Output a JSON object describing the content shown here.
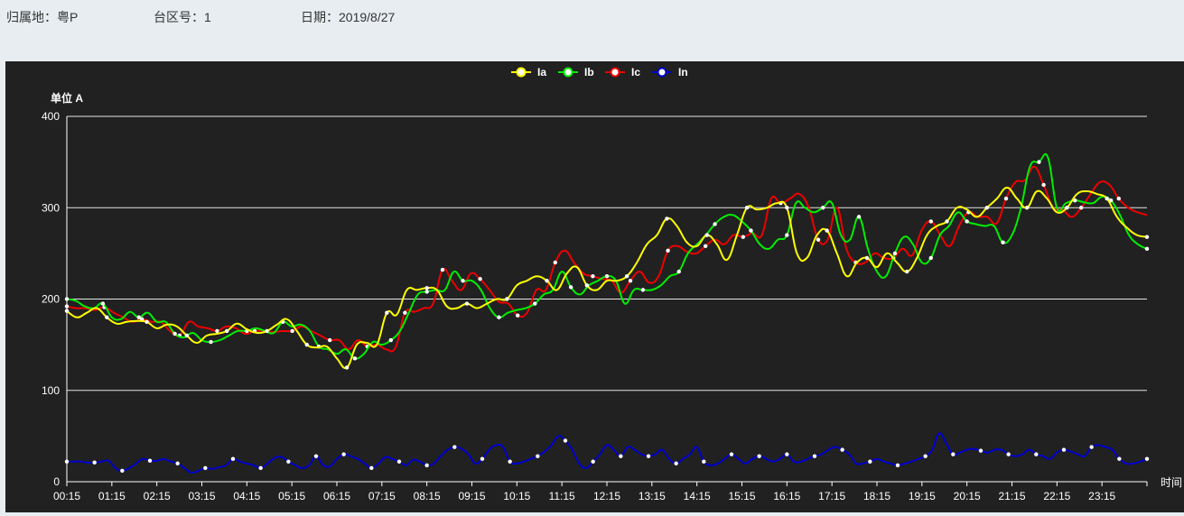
{
  "header": {
    "region_label": "归属地：",
    "region_value": "粤P",
    "station_label": "台区号：",
    "station_value": "1",
    "date_label": "日期：",
    "date_value": "2019/8/27"
  },
  "colors": {
    "page_bg": "#e8edf1",
    "chart_bg": "#212121",
    "Ia": "#ffff00",
    "Ib": "#00ee00",
    "Ic": "#ee0000",
    "In": "#0000cc"
  },
  "chart_data": {
    "type": "line",
    "ylabel": "单位 A",
    "xlabel": "时间",
    "ylim": [
      0,
      400
    ],
    "yticks": [
      0,
      100,
      200,
      300,
      400
    ],
    "grid": "horizontal",
    "legend_position": "top-center",
    "smooth": true,
    "x_tick_labels": [
      "00:15",
      "01:15",
      "02:15",
      "03:15",
      "04:15",
      "05:15",
      "06:15",
      "07:15",
      "08:15",
      "09:15",
      "10:15",
      "11:15",
      "12:15",
      "13:15",
      "14:15",
      "15:15",
      "16:15",
      "17:15",
      "18:15",
      "19:15",
      "20:15",
      "21:15",
      "22:15",
      "23:15"
    ],
    "x_start": "00:15",
    "x_interval_minutes": 15,
    "series": [
      {
        "name": "Ia",
        "values": [
          187,
          180,
          185,
          190,
          180,
          173,
          175,
          176,
          175,
          168,
          172,
          170,
          160,
          152,
          160,
          162,
          165,
          173,
          167,
          163,
          165,
          172,
          178,
          165,
          150,
          147,
          148,
          135,
          125,
          150,
          152,
          150,
          185,
          183,
          210,
          210,
          212,
          210,
          192,
          190,
          195,
          190,
          195,
          200,
          200,
          215,
          220,
          225,
          220,
          210,
          228,
          235,
          215,
          210,
          220,
          220,
          225,
          240,
          260,
          270,
          288,
          280,
          262,
          258,
          270,
          260,
          243,
          270,
          300,
          298,
          300,
          305,
          300,
          250,
          245,
          270,
          275,
          250,
          225,
          240,
          245,
          235,
          250,
          240,
          230,
          245,
          270,
          280,
          285,
          300,
          298,
          290,
          300,
          310,
          322,
          310,
          300,
          318,
          310,
          295,
          300,
          315,
          318,
          315,
          310,
          290,
          278,
          270,
          268
        ],
        "marker_every": 4
      },
      {
        "name": "Ib",
        "values": [
          200,
          198,
          192,
          190,
          195,
          180,
          178,
          186,
          180,
          185,
          175,
          175,
          162,
          158,
          163,
          155,
          153,
          155,
          160,
          165,
          165,
          168,
          165,
          163,
          175,
          170,
          172,
          165,
          148,
          145,
          140,
          145,
          135,
          140,
          153,
          150,
          155,
          165,
          185,
          205,
          208,
          210,
          210,
          230,
          220,
          220,
          210,
          190,
          180,
          185,
          188,
          190,
          195,
          205,
          210,
          230,
          213,
          205,
          215,
          220,
          225,
          220,
          195,
          210,
          210,
          210,
          215,
          225,
          230,
          250,
          260,
          270,
          282,
          290,
          292,
          285,
          275,
          260,
          255,
          265,
          270,
          305,
          300,
          295,
          300,
          305,
          270,
          265,
          290,
          255,
          230,
          225,
          250,
          268,
          260,
          240,
          245,
          270,
          280,
          295,
          285,
          282,
          280,
          280,
          262,
          270,
          300,
          345,
          350,
          355,
          300,
          305,
          308,
          306,
          305,
          312,
          308,
          292,
          270,
          260,
          255
        ],
        "marker_every": 4
      },
      {
        "name": "Ic",
        "values": [
          192,
          190,
          190,
          188,
          191,
          185,
          180,
          175,
          178,
          175,
          175,
          165,
          160,
          175,
          170,
          168,
          165,
          170,
          168,
          162,
          165,
          165,
          164,
          165,
          165,
          170,
          165,
          160,
          155,
          155,
          145,
          155,
          148,
          150,
          145,
          147,
          185,
          186,
          190,
          195,
          232,
          220,
          210,
          228,
          222,
          210,
          197,
          195,
          182,
          185,
          210,
          210,
          240,
          253,
          240,
          228,
          225,
          222,
          220,
          207,
          220,
          230,
          218,
          225,
          253,
          258,
          252,
          250,
          258,
          265,
          260,
          270,
          268,
          272,
          270,
          310,
          305,
          310,
          315,
          300,
          265,
          265,
          300,
          255,
          240,
          240,
          250,
          245,
          245,
          255,
          248,
          275,
          285,
          270,
          258,
          280,
          295,
          290,
          290,
          283,
          310,
          328,
          330,
          345,
          325,
          300,
          298,
          290,
          300,
          315,
          328,
          325,
          310,
          300,
          295,
          292
        ],
        "marker_every": 4
      },
      {
        "name": "In",
        "values": [
          22,
          22,
          22,
          21,
          21,
          22,
          23,
          15,
          12,
          15,
          20,
          25,
          23,
          23,
          25,
          22,
          20,
          15,
          10,
          12,
          15,
          14,
          16,
          18,
          25,
          22,
          20,
          18,
          15,
          20,
          26,
          27,
          22,
          18,
          15,
          18,
          28,
          18,
          17,
          25,
          30,
          28,
          25,
          20,
          15,
          20,
          27,
          25,
          22,
          18,
          24,
          22,
          18,
          20,
          28,
          35,
          38,
          36,
          30,
          20,
          25,
          35,
          40,
          38,
          22,
          20,
          22,
          25,
          28,
          33,
          40,
          50,
          45,
          35,
          20,
          15,
          22,
          30,
          40,
          35,
          28,
          38,
          35,
          30,
          28,
          30,
          35,
          25,
          20,
          25,
          30,
          38,
          22,
          18,
          20,
          25,
          30,
          25,
          20,
          25,
          28,
          25,
          22,
          25,
          30,
          22,
          22,
          25,
          28,
          30,
          35,
          38,
          35,
          30,
          20,
          20,
          22,
          25,
          22,
          20,
          18,
          20,
          22,
          25,
          28,
          35,
          53,
          42,
          30,
          32,
          35,
          36,
          34,
          32,
          35,
          35,
          30,
          28,
          30,
          35,
          30,
          28,
          25,
          32,
          35,
          33,
          30,
          28,
          38,
          40,
          38,
          35,
          25,
          20,
          20,
          22,
          25
        ],
        "marker_every": 4
      }
    ]
  }
}
